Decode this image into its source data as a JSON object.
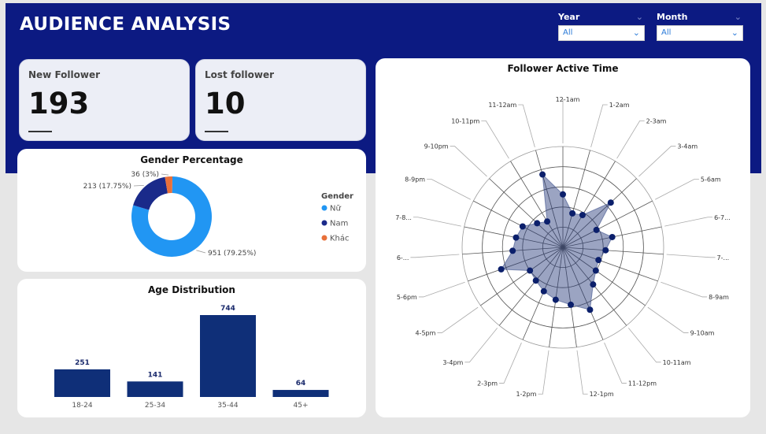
{
  "header": {
    "title": "AUDIENCE ANALYSIS"
  },
  "filters": {
    "year": {
      "label": "Year",
      "value": "All"
    },
    "month": {
      "label": "Month",
      "value": "All"
    }
  },
  "kpis": {
    "new_follower": {
      "label": "New Follower",
      "value": "193"
    },
    "lost_follower": {
      "label": "Lost follower",
      "value": "10"
    }
  },
  "gender_chart": {
    "title": "Gender Percentage",
    "legend_title": "Gender",
    "colors": {
      "Nữ": "#2196f3",
      "Nam": "#1a2a8a",
      "Khác": "#e8703a"
    }
  },
  "age_chart": {
    "title": "Age Distribution"
  },
  "radar_chart": {
    "title": "Follower Active Time"
  },
  "chart_data": [
    {
      "type": "pie",
      "title": "Gender Percentage",
      "legend_title": "Gender",
      "categories": [
        "Nữ",
        "Nam",
        "Khác"
      ],
      "values": [
        951,
        213,
        36
      ],
      "labels": [
        "951 (79.25%)",
        "213 (17.75%)",
        "36 (3%)"
      ]
    },
    {
      "type": "bar",
      "title": "Age Distribution",
      "categories": [
        "18-24",
        "25-34",
        "35-44",
        "45+"
      ],
      "values": [
        251,
        141,
        744,
        64
      ],
      "ylim": [
        0,
        800
      ]
    },
    {
      "type": "radar",
      "title": "Follower Active Time",
      "categories": [
        "12-1am",
        "1-2am",
        "2-3am",
        "3-4am",
        "5-6am",
        "6-7...",
        "7-...",
        "8-9am",
        "9-10am",
        "10-11am",
        "11-12pm",
        "12-1pm",
        "1-2pm",
        "2-3pm",
        "3-4pm",
        "4-5pm",
        "5-6pm",
        "6-...",
        "7-8...",
        "8-9pm",
        "9-10pm",
        "10-11pm",
        "11-12am"
      ],
      "values": [
        1.05,
        0.7,
        0.75,
        1.3,
        0.75,
        1.0,
        0.85,
        0.75,
        0.8,
        0.95,
        1.35,
        1.15,
        1.05,
        0.95,
        0.85,
        0.8,
        1.3,
        1.0,
        0.95,
        0.9,
        0.7,
        0.6,
        1.5
      ],
      "rlim": [
        0,
        2
      ],
      "grid": true
    }
  ]
}
